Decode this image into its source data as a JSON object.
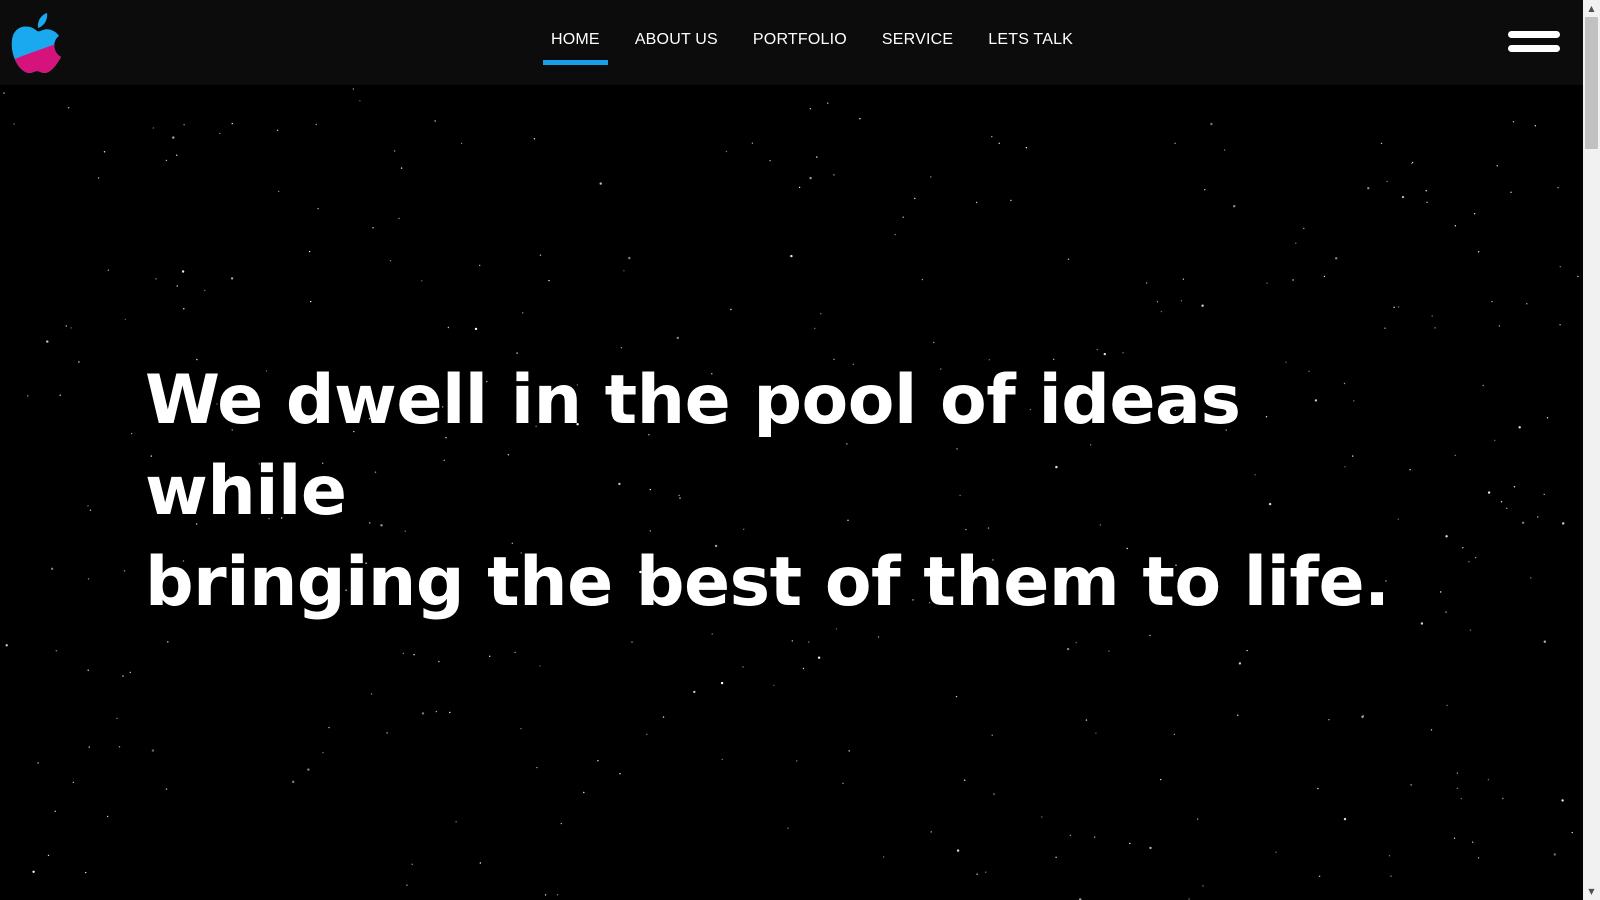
{
  "header": {
    "logo_name": "apple-logo",
    "nav": [
      {
        "label": "HOME",
        "active": true
      },
      {
        "label": "ABOUT US",
        "active": false
      },
      {
        "label": "PORTFOLIO",
        "active": false
      },
      {
        "label": "SERVICE",
        "active": false
      },
      {
        "label": "LETS TALK",
        "active": false
      }
    ],
    "menu_icon": "hamburger-menu-icon"
  },
  "hero": {
    "line1": "We dwell in the pool of ideas while",
    "line2": "bringing the best of them to life."
  },
  "colors": {
    "background": "#000000",
    "header_background": "#0c0c0c",
    "accent": "#1a9fe6",
    "logo_top": "#1aa8ef",
    "logo_bottom": "#d6137c",
    "text": "#ffffff"
  }
}
